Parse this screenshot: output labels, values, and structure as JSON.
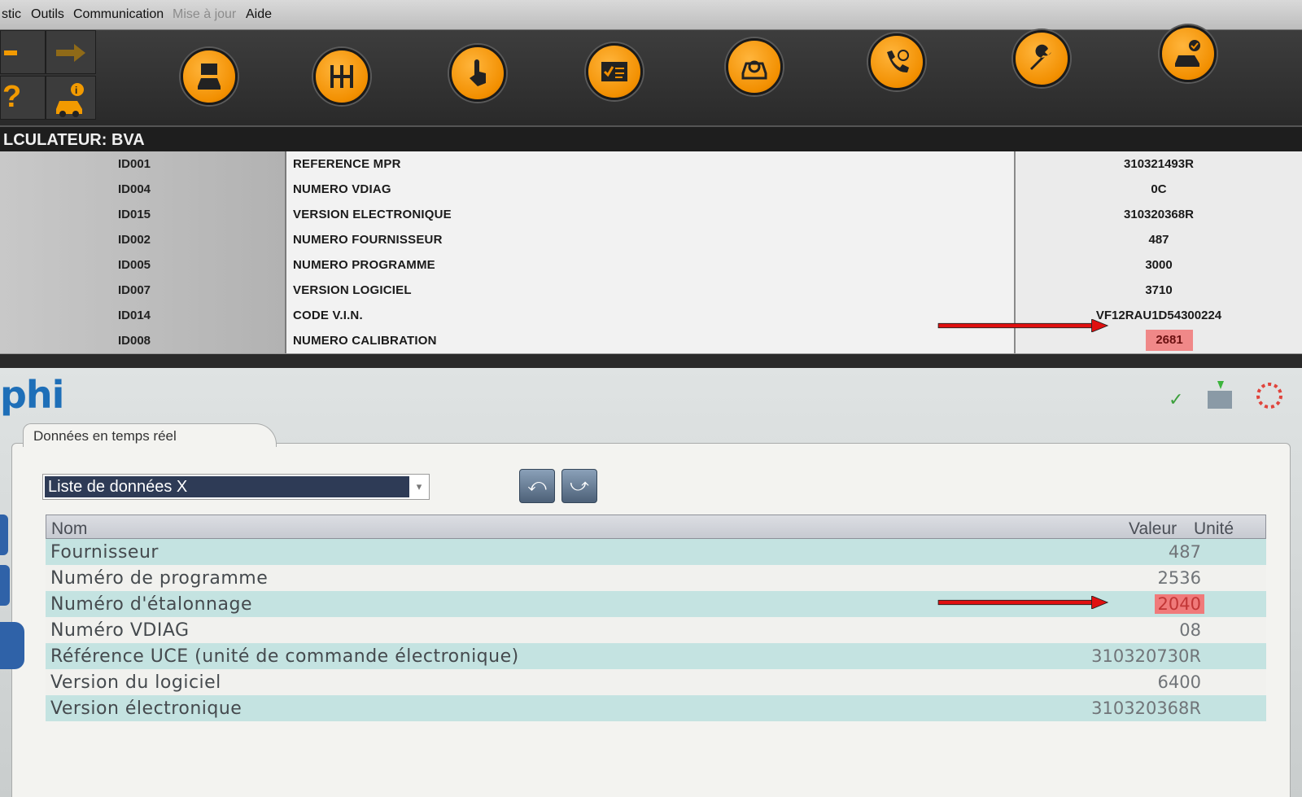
{
  "top_app": {
    "menu": [
      "stic",
      "Outils",
      "Communication",
      "Mise à jour",
      "Aide"
    ],
    "toolbar_icons": [
      "car-screen-icon",
      "gearbox-icon",
      "touch-hand-icon",
      "checklist-icon",
      "car-diagnostic-icon",
      "phone-support-icon",
      "wrench-icon",
      "car-check-icon"
    ],
    "left_buttons": [
      "minus-icon",
      "forward-arrow-icon",
      "help-question-icon",
      "car-info-icon"
    ],
    "ecu_title": "LCULATEUR: BVA",
    "rows": [
      {
        "id": "ID001",
        "label": "REFERENCE MPR",
        "value": "310321493R"
      },
      {
        "id": "ID004",
        "label": "NUMERO VDIAG",
        "value": "0C"
      },
      {
        "id": "ID015",
        "label": "VERSION ELECTRONIQUE",
        "value": "310320368R"
      },
      {
        "id": "ID002",
        "label": "NUMERO FOURNISSEUR",
        "value": "487"
      },
      {
        "id": "ID005",
        "label": "NUMERO PROGRAMME",
        "value": "3000"
      },
      {
        "id": "ID007",
        "label": "VERSION LOGICIEL",
        "value": "3710"
      },
      {
        "id": "ID014",
        "label": "CODE V.I.N.",
        "value": "VF12RAU1D54300224"
      },
      {
        "id": "ID008",
        "label": "NUMERO CALIBRATION",
        "value": "2681"
      }
    ]
  },
  "bottom_app": {
    "brand": "phi",
    "tab_label": "Données en temps réel",
    "list_select": "Liste de données X",
    "nav_buttons": {
      "back": "⤺",
      "forward": "⤻"
    },
    "columns": {
      "name": "Nom",
      "value": "Valeur",
      "unit": "Unité"
    },
    "rows": [
      {
        "name": "Fournisseur",
        "value": "487"
      },
      {
        "name": "Numéro de programme",
        "value": "2536"
      },
      {
        "name": "Numéro d'étalonnage",
        "value": "2040"
      },
      {
        "name": "Numéro VDIAG",
        "value": "08"
      },
      {
        "name": "Référence UCE (unité de commande électronique)",
        "value": "310320730R"
      },
      {
        "name": "Version du logiciel",
        "value": "6400"
      },
      {
        "name": "Version électronique",
        "value": "310320368R"
      }
    ]
  },
  "colors": {
    "orange": "#f28f00",
    "highlight": "#f08080",
    "arrow": "#e01010",
    "teal_row": "#c4e3e1",
    "brand_blue": "#1e6fb8"
  }
}
